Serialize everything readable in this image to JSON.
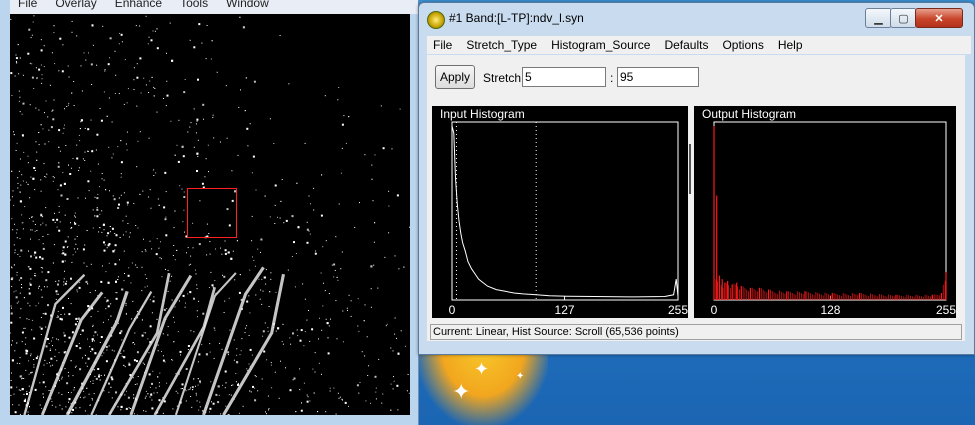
{
  "image_window": {
    "menu": [
      "File",
      "Overlay",
      "Enhance",
      "Tools",
      "Window"
    ]
  },
  "hist_window": {
    "title": "#1 Band:[L-TP]:ndv_l.syn",
    "menu": [
      "File",
      "Stretch_Type",
      "Histogram_Source",
      "Defaults",
      "Options",
      "Help"
    ],
    "apply_label": "Apply",
    "stretch_label": "Stretch",
    "stretch_low": "5",
    "stretch_separator": ":",
    "stretch_high": "95",
    "status": "Current: Linear, Hist Source: Scroll (65,536 points)"
  },
  "chart_data": [
    {
      "type": "line",
      "title": "Input Histogram",
      "x_ticks": [
        "0",
        "127",
        "255"
      ],
      "xlim": [
        0,
        255
      ],
      "line_color": "#ffffff",
      "stretch_markers": [
        5,
        95
      ],
      "series": [
        {
          "x": [
            0,
            2,
            4,
            6,
            8,
            10,
            12,
            15,
            18,
            22,
            26,
            30,
            35,
            40,
            50,
            60,
            70,
            80,
            95,
            110,
            130,
            160,
            200,
            240,
            250,
            253,
            255
          ],
          "values": [
            1.0,
            0.96,
            0.7,
            0.55,
            0.45,
            0.38,
            0.33,
            0.28,
            0.22,
            0.18,
            0.15,
            0.12,
            0.1,
            0.08,
            0.06,
            0.05,
            0.04,
            0.035,
            0.03,
            0.025,
            0.022,
            0.02,
            0.018,
            0.02,
            0.03,
            0.12,
            0.02
          ]
        }
      ]
    },
    {
      "type": "bar",
      "title": "Output Histogram",
      "x_ticks": [
        "0",
        "128",
        "255"
      ],
      "xlim": [
        0,
        255
      ],
      "bar_color": "#ff1a1a",
      "series": [
        {
          "x": [
            0,
            3,
            6,
            9,
            12,
            15,
            20,
            25,
            30,
            40,
            50,
            60,
            80,
            100,
            130,
            160,
            200,
            240,
            250,
            255
          ],
          "values": [
            1.0,
            0.6,
            0.14,
            0.12,
            0.1,
            0.11,
            0.09,
            0.1,
            0.08,
            0.07,
            0.07,
            0.06,
            0.05,
            0.05,
            0.04,
            0.04,
            0.03,
            0.03,
            0.04,
            0.16
          ]
        }
      ]
    }
  ],
  "colors": {
    "titlebar": "#c9dbef",
    "close_button": "#c8442a",
    "zoom_box": "#ff2020",
    "desktop": "#2a7fc8"
  }
}
